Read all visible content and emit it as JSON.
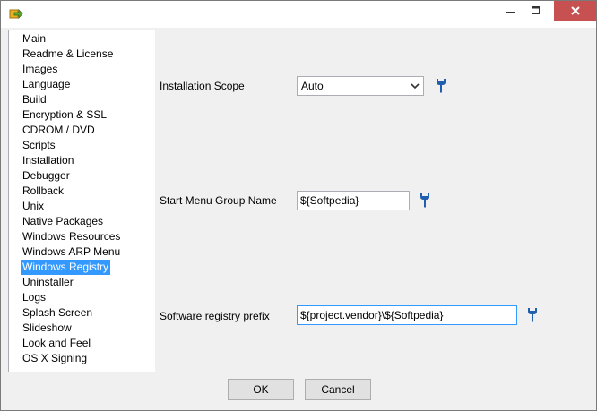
{
  "window": {
    "icons": {
      "app": "arrow-app-icon",
      "minimize": "minimize-icon",
      "maximize": "maximize-icon",
      "close": "close-icon"
    },
    "close_color": "#c75050"
  },
  "sidebar": {
    "selected_index": 15,
    "selected_color": "#3399ff",
    "items": [
      {
        "label": "Main"
      },
      {
        "label": "Readme & License"
      },
      {
        "label": "Images"
      },
      {
        "label": "Language"
      },
      {
        "label": "Build"
      },
      {
        "label": "Encryption & SSL"
      },
      {
        "label": "CDROM / DVD"
      },
      {
        "label": "Scripts"
      },
      {
        "label": "Installation"
      },
      {
        "label": "Debugger"
      },
      {
        "label": "Rollback"
      },
      {
        "label": "Unix"
      },
      {
        "label": "Native Packages"
      },
      {
        "label": "Windows Resources"
      },
      {
        "label": "Windows ARP Menu"
      },
      {
        "label": "Windows Registry"
      },
      {
        "label": "Uninstaller"
      },
      {
        "label": "Logs"
      },
      {
        "label": "Splash Screen"
      },
      {
        "label": "Slideshow"
      },
      {
        "label": "Look and Feel"
      },
      {
        "label": "OS X Signing"
      }
    ]
  },
  "form": {
    "scope_label": "Installation Scope",
    "scope_value": "Auto",
    "start_menu_label": "Start Menu Group Name",
    "start_menu_value": "${Softpedia}",
    "registry_prefix_label": "Software registry prefix",
    "registry_prefix_value": "${project.vendor}\\${Softpedia}",
    "tool_icon": "wrench-icon",
    "tool_icon_color": "#1f5fae"
  },
  "buttons": {
    "ok_label": "OK",
    "cancel_label": "Cancel"
  }
}
